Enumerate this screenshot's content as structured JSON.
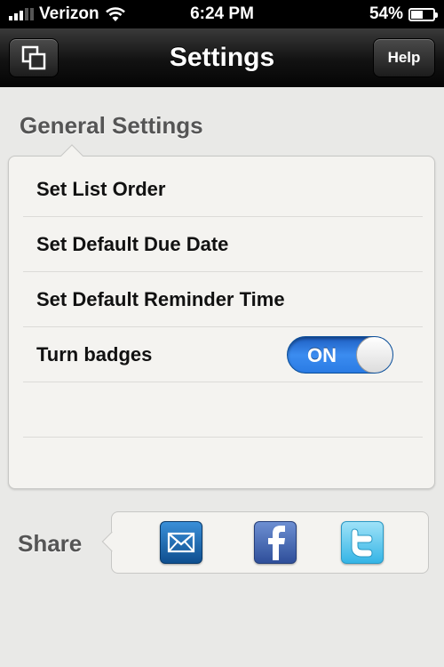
{
  "status_bar": {
    "carrier": "Verizon",
    "time": "6:24 PM",
    "battery": "54%",
    "battery_level": 0.54
  },
  "nav": {
    "title": "Settings",
    "help_label": "Help",
    "left_icon": "windows-icon"
  },
  "general": {
    "section_title": "General Settings",
    "rows": [
      {
        "label": "Set List Order"
      },
      {
        "label": "Set Default Due Date"
      },
      {
        "label": "Set Default Reminder Time"
      },
      {
        "label": "Turn badges",
        "toggle": "ON",
        "toggle_on": true
      }
    ]
  },
  "share": {
    "label": "Share",
    "icons": [
      "email-icon",
      "facebook-icon",
      "twitter-icon"
    ]
  },
  "colors": {
    "toggle_blue": "#2a7be4",
    "facebook": "#3b5998",
    "twitter": "#35b5e6"
  }
}
